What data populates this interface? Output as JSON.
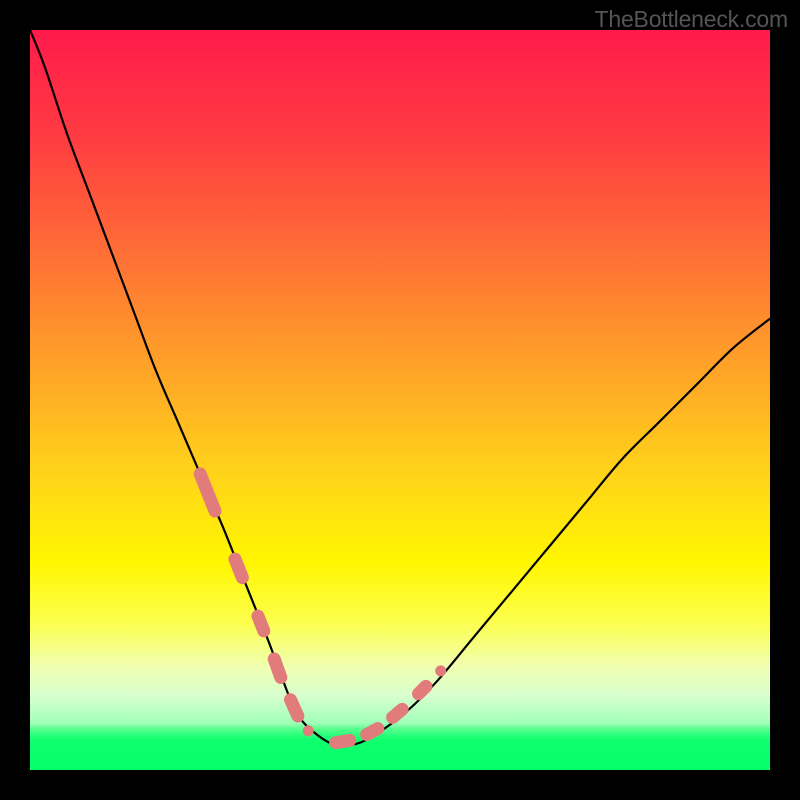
{
  "watermark": "TheBottleneck.com",
  "chart_data": {
    "type": "line",
    "title": "",
    "xlabel": "",
    "ylabel": "",
    "xlim": [
      0,
      100
    ],
    "ylim": [
      0,
      100
    ],
    "gradient_stops": [
      {
        "offset": 0,
        "color": "#ff1a4b"
      },
      {
        "offset": 14,
        "color": "#ff3a42"
      },
      {
        "offset": 30,
        "color": "#ff6e36"
      },
      {
        "offset": 45,
        "color": "#ffa128"
      },
      {
        "offset": 60,
        "color": "#ffd31a"
      },
      {
        "offset": 72,
        "color": "#fff600"
      },
      {
        "offset": 80,
        "color": "#fdff4d"
      },
      {
        "offset": 86,
        "color": "#f0ffb0"
      },
      {
        "offset": 90,
        "color": "#d8ffcf"
      },
      {
        "offset": 93.7,
        "color": "#9fffb8"
      },
      {
        "offset": 94.4,
        "color": "#5cff90"
      },
      {
        "offset": 95.2,
        "color": "#2dff7c"
      },
      {
        "offset": 96,
        "color": "#0fff6e"
      },
      {
        "offset": 100,
        "color": "#05ff68"
      }
    ],
    "series": [
      {
        "name": "main-curve",
        "x": [
          0,
          2,
          5,
          8,
          11,
          14,
          17,
          20,
          23,
          26,
          28,
          30,
          32,
          33.5,
          35,
          36.5,
          38.5,
          41,
          44,
          47,
          51,
          55,
          60,
          65,
          70,
          75,
          80,
          85,
          90,
          95,
          100
        ],
        "y": [
          100,
          95,
          86,
          78,
          70,
          62,
          54,
          47,
          40,
          33,
          28,
          23,
          18,
          14,
          10,
          7,
          5,
          3.5,
          3.5,
          5,
          8,
          12,
          18,
          24,
          30,
          36,
          42,
          47,
          52,
          57,
          61
        ],
        "color": "#000000",
        "width": 2.2
      }
    ],
    "bead_segments": [
      {
        "side": "left",
        "x": [
          23.0,
          25.0,
          27.7,
          28.7,
          30.8,
          31.6,
          33.0,
          33.9,
          35.2,
          36.2,
          37.6
        ],
        "y": [
          40.0,
          35.0,
          28.5,
          26.0,
          20.8,
          18.8,
          15.0,
          12.5,
          9.5,
          7.3,
          5.3
        ]
      },
      {
        "side": "right",
        "x": [
          41.3,
          43.2,
          45.5,
          47.0,
          49.0,
          50.3,
          52.5,
          53.5,
          55.5
        ],
        "y": [
          3.7,
          4.0,
          4.8,
          5.6,
          7.1,
          8.2,
          10.3,
          11.3,
          13.4
        ]
      }
    ],
    "bead_style": {
      "color": "#e27c7c",
      "radius": 6.5,
      "cap_radius": 5.5
    }
  }
}
